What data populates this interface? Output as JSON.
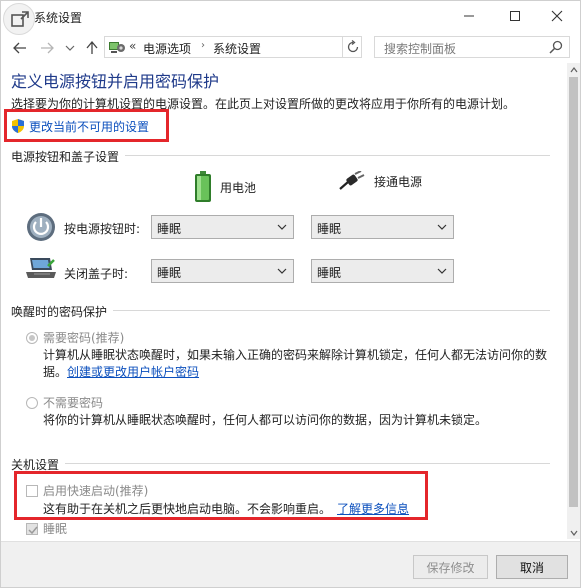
{
  "window": {
    "title": "系统设置"
  },
  "address": {
    "overflow": "«",
    "crumbs": [
      "电源选项",
      "系统设置"
    ]
  },
  "search": {
    "placeholder": "搜索控制面板"
  },
  "page": {
    "title": "定义电源按钮并启用密码保护",
    "intro": "选择要为你的计算机设置的电源设置。在此页上对设置所做的更改将应用于你所有的电源计划。",
    "change_link": "更改当前不可用的设置"
  },
  "power": {
    "section_title": "电源按钮和盖子设置",
    "col_battery": "用电池",
    "col_ac": "接通电源",
    "rows": [
      {
        "label": "按电源按钮时:",
        "battery": "睡眠",
        "ac": "睡眠"
      },
      {
        "label": "关闭盖子时:",
        "battery": "睡眠",
        "ac": "睡眠"
      }
    ]
  },
  "wake": {
    "section_title": "唤醒时的密码保护",
    "require_label": "需要密码(推荐)",
    "require_desc_1": "计算机从睡眠状态唤醒时，如果未输入正确的密码来解除计算机锁定，任何人都无法访问你的数",
    "require_desc_2": "据。",
    "require_link": "创建或更改用户帐户密码",
    "none_label": "不需要密码",
    "none_desc": "将你的计算机从睡眠状态唤醒时，任何人都可以访问你的数据，因为计算机未锁定。"
  },
  "shutdown": {
    "section_title": "关机设置",
    "fast_startup_label": "启用快速启动(推荐)",
    "fast_startup_desc": "这有助于在关机之后更快地启动电脑。不会影响重启。",
    "learn_more": "了解更多信息",
    "sleep_label": "睡眠"
  },
  "footer": {
    "save": "保存修改",
    "cancel": "取消"
  },
  "colors": {
    "title_blue": "#1f3a8a",
    "link_blue": "#0b4fbd",
    "highlight_red": "#e4262b"
  }
}
